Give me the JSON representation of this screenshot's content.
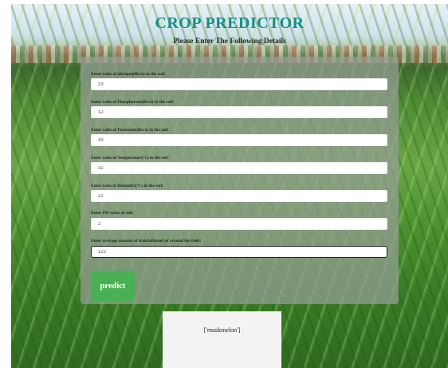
{
  "header": {
    "title": "CROP PREDICTOR",
    "subtitle": "Please Enter The Following Details"
  },
  "form": {
    "fields": [
      {
        "label": "Enter ratio of nitrogen(lbs/a) in the soil:",
        "value": "23"
      },
      {
        "label": "Enter ratio of Phosphorous(lbs/a) in the soil:",
        "value": "12"
      },
      {
        "label": "Enter ratio of Potassium(lbs/a) in the soil:",
        "value": "43"
      },
      {
        "label": "Enter ratio of Temperature(°c) in the soil:",
        "value": "32"
      },
      {
        "label": "Enter ratio of Humidity(%) in the soil:",
        "value": "22"
      },
      {
        "label": "Enter PH value of soil:",
        "value": "2"
      },
      {
        "label": "Enter average amount of Rainfall(mm) of around the field:",
        "value": "122"
      }
    ],
    "predict_label": "predict"
  },
  "result": {
    "text": "['muskmelon']"
  },
  "colors": {
    "title": "#138f86",
    "predict_button": "#49b153",
    "panel": "#96a096",
    "result_box": "#f3f3f3"
  }
}
